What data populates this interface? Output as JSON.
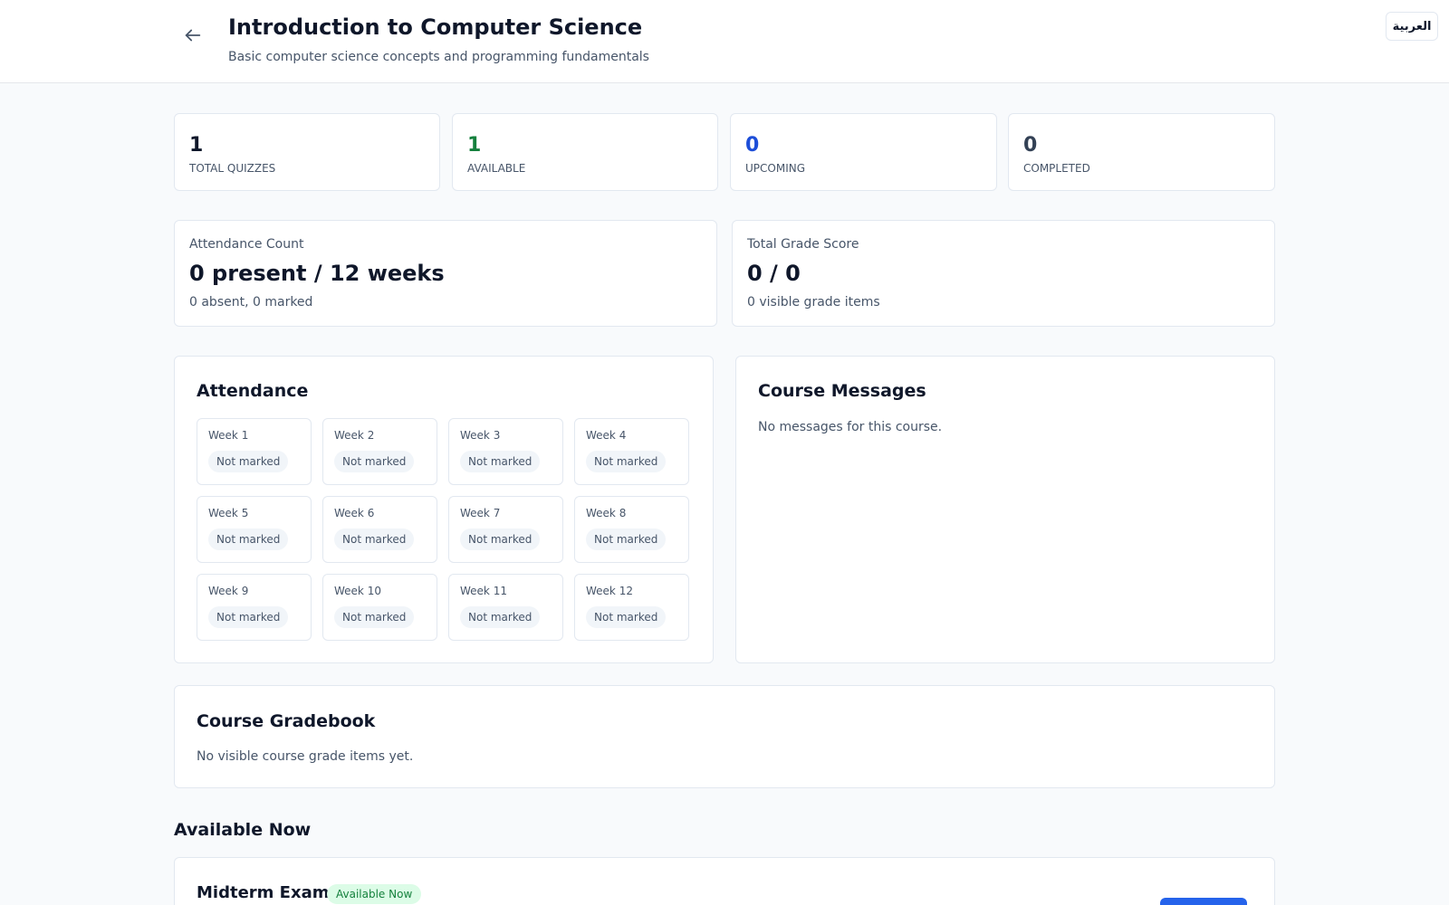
{
  "header": {
    "title": "Introduction to Computer Science",
    "subtitle": "Basic computer science concepts and programming fundamentals",
    "back_icon": "arrow-left-icon",
    "language_button": "العربية"
  },
  "stats": [
    {
      "value": "1",
      "label": "TOTAL QUIZZES",
      "color": "#0f172a"
    },
    {
      "value": "1",
      "label": "AVAILABLE",
      "color": "#15803d"
    },
    {
      "value": "0",
      "label": "UPCOMING",
      "color": "#1d4ed8"
    },
    {
      "value": "0",
      "label": "COMPLETED",
      "color": "#334155"
    }
  ],
  "attendance_summary": {
    "label": "Attendance Count",
    "value": "0 present / 12 weeks",
    "sub": "0 absent, 0 marked"
  },
  "grade_summary": {
    "label": "Total Grade Score",
    "value": "0 / 0",
    "sub": "0 visible grade items"
  },
  "attendance": {
    "title": "Attendance",
    "weeks": [
      {
        "label": "Week 1",
        "status": "Not marked"
      },
      {
        "label": "Week 2",
        "status": "Not marked"
      },
      {
        "label": "Week 3",
        "status": "Not marked"
      },
      {
        "label": "Week 4",
        "status": "Not marked"
      },
      {
        "label": "Week 5",
        "status": "Not marked"
      },
      {
        "label": "Week 6",
        "status": "Not marked"
      },
      {
        "label": "Week 7",
        "status": "Not marked"
      },
      {
        "label": "Week 8",
        "status": "Not marked"
      },
      {
        "label": "Week 9",
        "status": "Not marked"
      },
      {
        "label": "Week 10",
        "status": "Not marked"
      },
      {
        "label": "Week 11",
        "status": "Not marked"
      },
      {
        "label": "Week 12",
        "status": "Not marked"
      }
    ]
  },
  "messages": {
    "title": "Course Messages",
    "empty": "No messages for this course."
  },
  "gradebook": {
    "title": "Course Gradebook",
    "empty": "No visible course grade items yet."
  },
  "available_now": {
    "heading": "Available Now",
    "quiz": {
      "title": "Midterm Exam",
      "badge": "Available Now",
      "accent": "#2563eb"
    }
  }
}
